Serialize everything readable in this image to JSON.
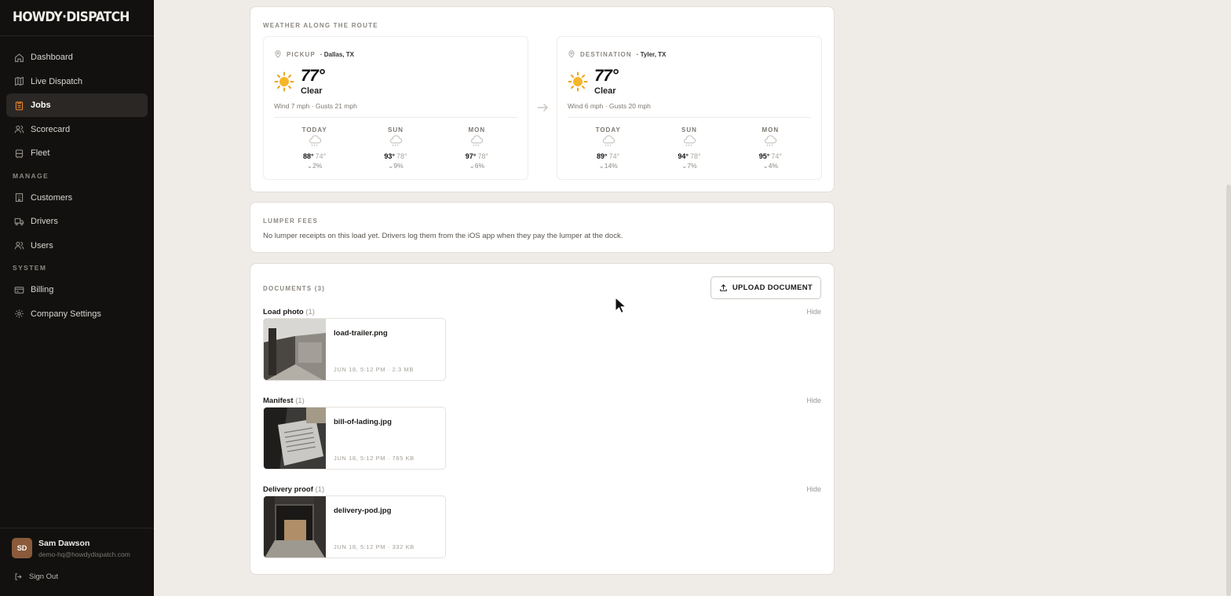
{
  "brand": {
    "name": "HOWDY·DISPATCH"
  },
  "sidebar": {
    "nav": [
      {
        "label": "Dashboard",
        "icon": "home-icon"
      },
      {
        "label": "Live Dispatch",
        "icon": "map-icon"
      },
      {
        "label": "Jobs",
        "icon": "clipboard-icon",
        "active": true
      },
      {
        "label": "Scorecard",
        "icon": "users-icon"
      },
      {
        "label": "Fleet",
        "icon": "truck-icon"
      }
    ],
    "section_manage": "MANAGE",
    "manage": [
      {
        "label": "Customers",
        "icon": "building-icon"
      },
      {
        "label": "Drivers",
        "icon": "steering-icon"
      },
      {
        "label": "Users",
        "icon": "user-group-icon"
      }
    ],
    "section_system": "SYSTEM",
    "system": [
      {
        "label": "Billing",
        "icon": "card-icon"
      },
      {
        "label": "Company Settings",
        "icon": "gear-icon"
      }
    ],
    "user": {
      "initials": "SD",
      "name": "Sam Dawson",
      "email": "demo-hq@howdydispatch.com"
    },
    "signout": "Sign Out"
  },
  "weather": {
    "label": "WEATHER ALONG THE ROUTE",
    "pickup": {
      "kind": "PICKUP",
      "city": "· Dallas, TX",
      "temp": "77°",
      "condition": "Clear",
      "wind": "Wind 7 mph · Gusts 21 mph",
      "forecast": [
        {
          "day": "TODAY",
          "hi": "88°",
          "lo": "74°",
          "precip": "2%"
        },
        {
          "day": "SUN",
          "hi": "93°",
          "lo": "78°",
          "precip": "9%"
        },
        {
          "day": "MON",
          "hi": "97°",
          "lo": "78°",
          "precip": "6%"
        }
      ]
    },
    "destination": {
      "kind": "DESTINATION",
      "city": "· Tyler, TX",
      "temp": "77°",
      "condition": "Clear",
      "wind": "Wind 6 mph · Gusts 20 mph",
      "forecast": [
        {
          "day": "TODAY",
          "hi": "89°",
          "lo": "74°",
          "precip": "14%"
        },
        {
          "day": "SUN",
          "hi": "94°",
          "lo": "78°",
          "precip": "7%"
        },
        {
          "day": "MON",
          "hi": "95°",
          "lo": "74°",
          "precip": "4%"
        }
      ]
    }
  },
  "lumper": {
    "label": "LUMPER FEES",
    "text": "No lumper receipts on this load yet. Drivers log them from the iOS app when they pay the lumper at the dock."
  },
  "documents": {
    "label": "DOCUMENTS (3)",
    "upload_label": "UPLOAD DOCUMENT",
    "hide_label": "Hide",
    "groups": [
      {
        "title": "Load photo",
        "count": "(1)",
        "file": "load-trailer.png",
        "meta": "JUN 18, 5:12 PM · 2.3 MB"
      },
      {
        "title": "Manifest",
        "count": "(1)",
        "file": "bill-of-lading.jpg",
        "meta": "JUN 18, 5:12 PM · 765 KB"
      },
      {
        "title": "Delivery proof",
        "count": "(1)",
        "file": "delivery-pod.jpg",
        "meta": "JUN 18, 5:12 PM · 332 KB"
      }
    ]
  },
  "colors": {
    "accent": "#e2832c",
    "sidebar_bg": "#121110",
    "page_bg": "#efece8"
  }
}
